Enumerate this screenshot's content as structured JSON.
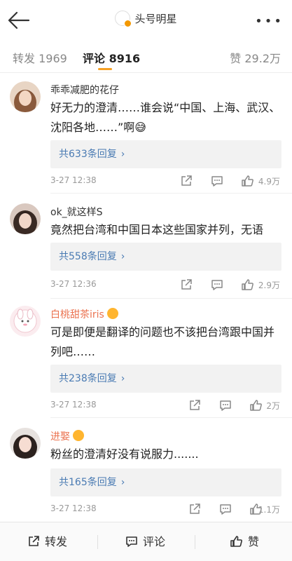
{
  "nav": {
    "title": "头号明星",
    "more": "•••"
  },
  "tabs": {
    "forward": "转发 1969",
    "comment": "评论 8916",
    "like": "赞 29.2万"
  },
  "comments": [
    {
      "user": "乖乖减肥的花仔",
      "text": "好无力的澄清……谁会说“中国、上海、武汉、沈阳各地……”啊😅",
      "replies": "共633条回复",
      "time": "3-27 12:38",
      "likes": "4.9万"
    },
    {
      "user": "ok_就这样S",
      "text": "竟然把台湾和中国日本这些国家并列，无语",
      "replies": "共558条回复",
      "time": "3-27 12:36",
      "likes": "2.9万"
    },
    {
      "user": "白桃甜茶iris",
      "text": "可是即便是翻译的问题也不该把台湾跟中国并列吧……",
      "replies": "共238条回复",
      "time": "3-27 12:38",
      "likes": "2万"
    },
    {
      "user": "进娶",
      "text": "粉丝的澄清好没有说服力.......",
      "replies": "共165条回复",
      "time": "3-27 12:38",
      "likes": "1.1万"
    }
  ],
  "chevron": "›",
  "bottom": {
    "forward": "转发",
    "comment": "评论",
    "like": "赞"
  },
  "colors": {
    "accent": "#f7a023",
    "link": "#4a7bb3",
    "vip_name": "#eb7350"
  }
}
